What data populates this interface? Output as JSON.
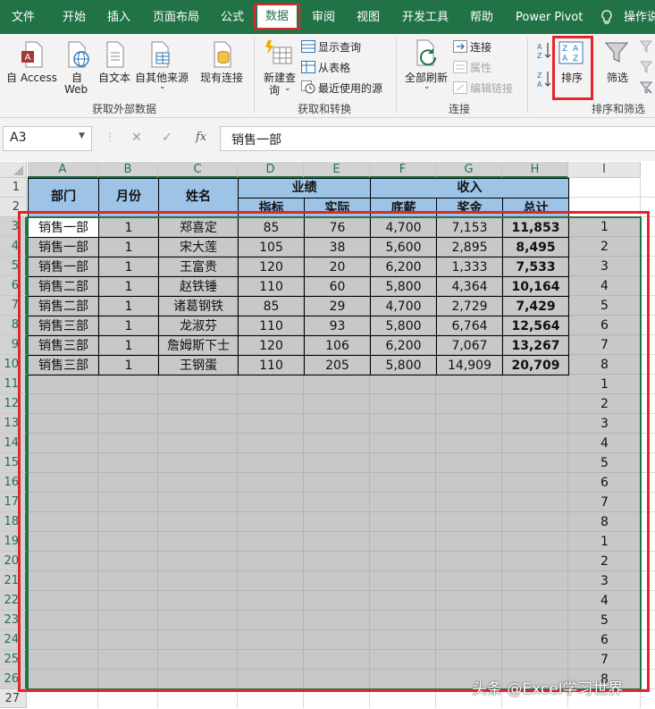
{
  "ribbon_tabs": [
    "文件",
    "开始",
    "插入",
    "页面布局",
    "公式",
    "数据",
    "审阅",
    "视图",
    "开发工具",
    "帮助",
    "Power Pivot",
    "操作说"
  ],
  "ribbon": {
    "get_external": {
      "access": "自 Access",
      "web_line1": "自",
      "web_line2": "Web",
      "text": "自文本",
      "other": "自其他来源",
      "existing": "现有连接",
      "group": "获取外部数据"
    },
    "get_transform": {
      "new_query_line1": "新建查",
      "new_query_line2": "询",
      "show_queries": "显示查询",
      "from_table": "从表格",
      "recent_sources": "最近使用的源",
      "group": "获取和转换"
    },
    "connections": {
      "refresh_all": "全部刷新",
      "connections": "连接",
      "properties": "属性",
      "edit_links": "编辑链接",
      "group": "连接"
    },
    "sort_filter": {
      "sort": "排序",
      "filter": "筛选",
      "sort_az": "A Z",
      "sort_za": "Z A",
      "group": "排序和筛选"
    }
  },
  "formula_bar": {
    "name_box": "A3",
    "fx": "fx",
    "content": "销售一部"
  },
  "columns": [
    "A",
    "B",
    "C",
    "D",
    "E",
    "F",
    "G",
    "H",
    "I"
  ],
  "row_numbers": [
    "1",
    "2",
    "3",
    "4",
    "5",
    "6",
    "7",
    "8",
    "9",
    "10",
    "11",
    "12",
    "13",
    "14",
    "15",
    "16",
    "17",
    "18",
    "19",
    "20",
    "21",
    "22",
    "23",
    "24",
    "25",
    "26",
    "27"
  ],
  "headers": {
    "dept": "部门",
    "month": "月份",
    "name": "姓名",
    "performance": "业绩",
    "target": "指标",
    "actual": "实际",
    "income": "收入",
    "base": "底薪",
    "bonus": "奖金",
    "total": "总计"
  },
  "rows": [
    [
      "销售一部",
      "1",
      "郑喜定",
      "85",
      "76",
      "4,700",
      "7,153",
      "11,853"
    ],
    [
      "销售一部",
      "1",
      "宋大莲",
      "105",
      "38",
      "5,600",
      "2,895",
      "8,495"
    ],
    [
      "销售一部",
      "1",
      "王富贵",
      "120",
      "20",
      "6,200",
      "1,333",
      "7,533"
    ],
    [
      "销售二部",
      "1",
      "赵铁锤",
      "110",
      "60",
      "5,800",
      "4,364",
      "10,164"
    ],
    [
      "销售二部",
      "1",
      "诸葛钢铁",
      "85",
      "29",
      "4,700",
      "2,729",
      "7,429"
    ],
    [
      "销售三部",
      "1",
      "龙淑芬",
      "110",
      "93",
      "5,800",
      "6,764",
      "12,564"
    ],
    [
      "销售三部",
      "1",
      "詹姆斯下士",
      "120",
      "106",
      "6,200",
      "7,067",
      "13,267"
    ],
    [
      "销售三部",
      "1",
      "王钢蛋",
      "110",
      "205",
      "5,800",
      "14,909",
      "20,709"
    ]
  ],
  "helper_column_I": [
    "1",
    "2",
    "3",
    "4",
    "5",
    "6",
    "7",
    "8",
    "1",
    "2",
    "3",
    "4",
    "5",
    "6",
    "7",
    "8",
    "1",
    "2",
    "3",
    "4",
    "5",
    "6",
    "7",
    "8"
  ],
  "watermark": "头条 @Excel学习世界",
  "colors": {
    "excel_green": "#217346",
    "header_blue": "#9dc3e6",
    "selection_gray": "#c8c8c8",
    "highlight_red": "#e3262b"
  }
}
